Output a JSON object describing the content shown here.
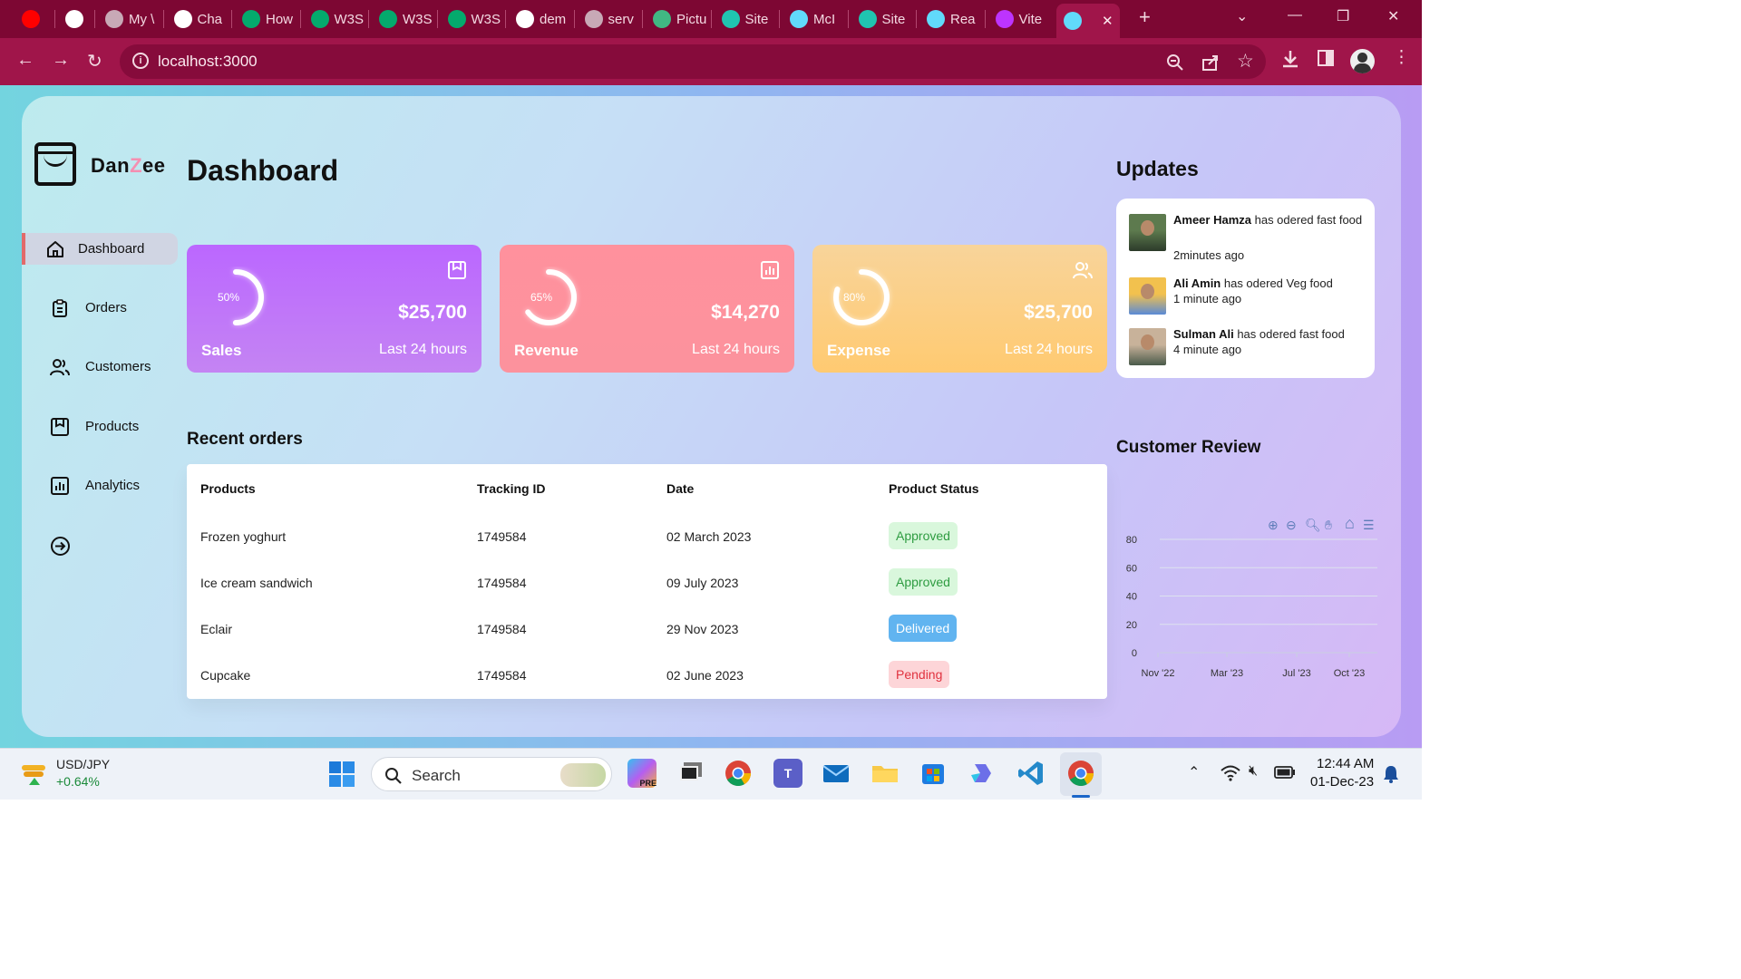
{
  "browser": {
    "tabs": [
      {
        "label": "",
        "icon": "youtube-icon",
        "color": "#ff0000"
      },
      {
        "label": "",
        "icon": "github-icon",
        "color": "#ffffff"
      },
      {
        "label": "My \\",
        "icon": "globe-icon",
        "color": "#c8a9b6"
      },
      {
        "label": "Cha",
        "icon": "openai-icon",
        "color": "#ffffff"
      },
      {
        "label": "How",
        "icon": "w3schools-icon",
        "color": "#04aa6d"
      },
      {
        "label": "W3S",
        "icon": "w3schools-icon",
        "color": "#04aa6d"
      },
      {
        "label": "W3S",
        "icon": "w3schools-icon",
        "color": "#04aa6d"
      },
      {
        "label": "W3S",
        "icon": "w3schools-icon",
        "color": "#04aa6d"
      },
      {
        "label": "dem",
        "icon": "google-icon",
        "color": "#ffffff"
      },
      {
        "label": "serv",
        "icon": "globe-icon",
        "color": "#c8a9b6"
      },
      {
        "label": "Pictu",
        "icon": "vue-icon",
        "color": "#41b883"
      },
      {
        "label": "Site",
        "icon": "diamond-icon",
        "color": "#20c4b0"
      },
      {
        "label": "McI",
        "icon": "react-icon",
        "color": "#61dafb"
      },
      {
        "label": "Site",
        "icon": "diamond-icon",
        "color": "#20c4b0"
      },
      {
        "label": "Rea",
        "icon": "react-icon",
        "color": "#61dafb"
      },
      {
        "label": "Vite",
        "icon": "vite-icon",
        "color": "#bd34fe"
      },
      {
        "label": "",
        "icon": "react-icon",
        "color": "#61dafb",
        "active": true
      }
    ],
    "url": "localhost:3000"
  },
  "sidebar": {
    "logo": {
      "part1": "Dan",
      "part2": "Z",
      "part3": "ee"
    },
    "items": [
      {
        "label": "Dashboard",
        "icon": "home-icon",
        "active": true
      },
      {
        "label": "Orders",
        "icon": "clipboard-icon"
      },
      {
        "label": "Customers",
        "icon": "users-icon"
      },
      {
        "label": "Products",
        "icon": "product-icon"
      },
      {
        "label": "Analytics",
        "icon": "bar-chart-icon"
      }
    ],
    "signout_icon": "sign-out-icon"
  },
  "main": {
    "title": "Dashboard",
    "cards": [
      {
        "name": "Sales",
        "amount": "$25,700",
        "period": "Last 24 hours",
        "percent_label": "50%",
        "percent": 50,
        "icon": "product-icon",
        "gradient_from": "#bb67ff",
        "gradient_to": "#c484f3"
      },
      {
        "name": "Revenue",
        "amount": "$14,270",
        "period": "Last 24 hours",
        "percent_label": "65%",
        "percent": 65,
        "icon": "bar-chart-icon",
        "gradient_from": "#ff919d",
        "gradient_to": "#fc929d"
      },
      {
        "name": "Expense",
        "amount": "$25,700",
        "period": "Last 24 hours",
        "percent_label": "80%",
        "percent": 80,
        "icon": "users-icon",
        "gradient_from": "#f8d49a",
        "gradient_to": "#ffca71"
      }
    ],
    "recent_orders": {
      "title": "Recent orders",
      "headers": [
        "Products",
        "Tracking ID",
        "Date",
        "Product Status"
      ],
      "rows": [
        {
          "product": "Frozen yoghurt",
          "tracking": "1749584",
          "date": "02 March 2023",
          "status": "Approved"
        },
        {
          "product": "Ice cream sandwich",
          "tracking": "1749584",
          "date": "09 July 2023",
          "status": "Approved"
        },
        {
          "product": "Eclair",
          "tracking": "1749584",
          "date": "29 Nov 2023",
          "status": "Delivered"
        },
        {
          "product": "Cupcake",
          "tracking": "1749584",
          "date": "02 June 2023",
          "status": "Pending"
        }
      ],
      "status_colors": {
        "Approved": {
          "bg": "#d9f7dc",
          "fg": "#2e9c41"
        },
        "Delivered": {
          "bg": "#61b4f0",
          "fg": "#ffffff"
        },
        "Pending": {
          "bg": "#fdd5d8",
          "fg": "#e0323f"
        }
      }
    }
  },
  "right": {
    "updates_title": "Updates",
    "updates": [
      {
        "name": "Ameer Hamza",
        "text": " has odered fast food",
        "time": "2minutes ago"
      },
      {
        "name": "Ali Amin",
        "text": " has odered Veg food",
        "time": "1 minute ago"
      },
      {
        "name": "Sulman Ali",
        "text": " has odered fast food",
        "time": "4 minute ago"
      }
    ],
    "review_title": "Customer Review",
    "chart_tools": [
      "zoom-in-icon",
      "zoom-out-icon",
      "zoom-select-icon",
      "pan-icon",
      "home-icon",
      "menu-icon"
    ]
  },
  "chart_data": {
    "type": "area",
    "title": "",
    "x": [
      "Nov '22",
      "Mar '23",
      "Jul '23",
      "Oct '23"
    ],
    "y_ticks": [
      "0",
      "20",
      "40",
      "60",
      "80"
    ],
    "ylim": [
      0,
      80
    ],
    "series": [],
    "grid": true,
    "legend": "none"
  },
  "taskbar": {
    "widget_title": "USD/JPY",
    "widget_value": "+0.64%",
    "search_label": "Search",
    "time": "12:44 AM",
    "date": "01-Dec-23"
  }
}
